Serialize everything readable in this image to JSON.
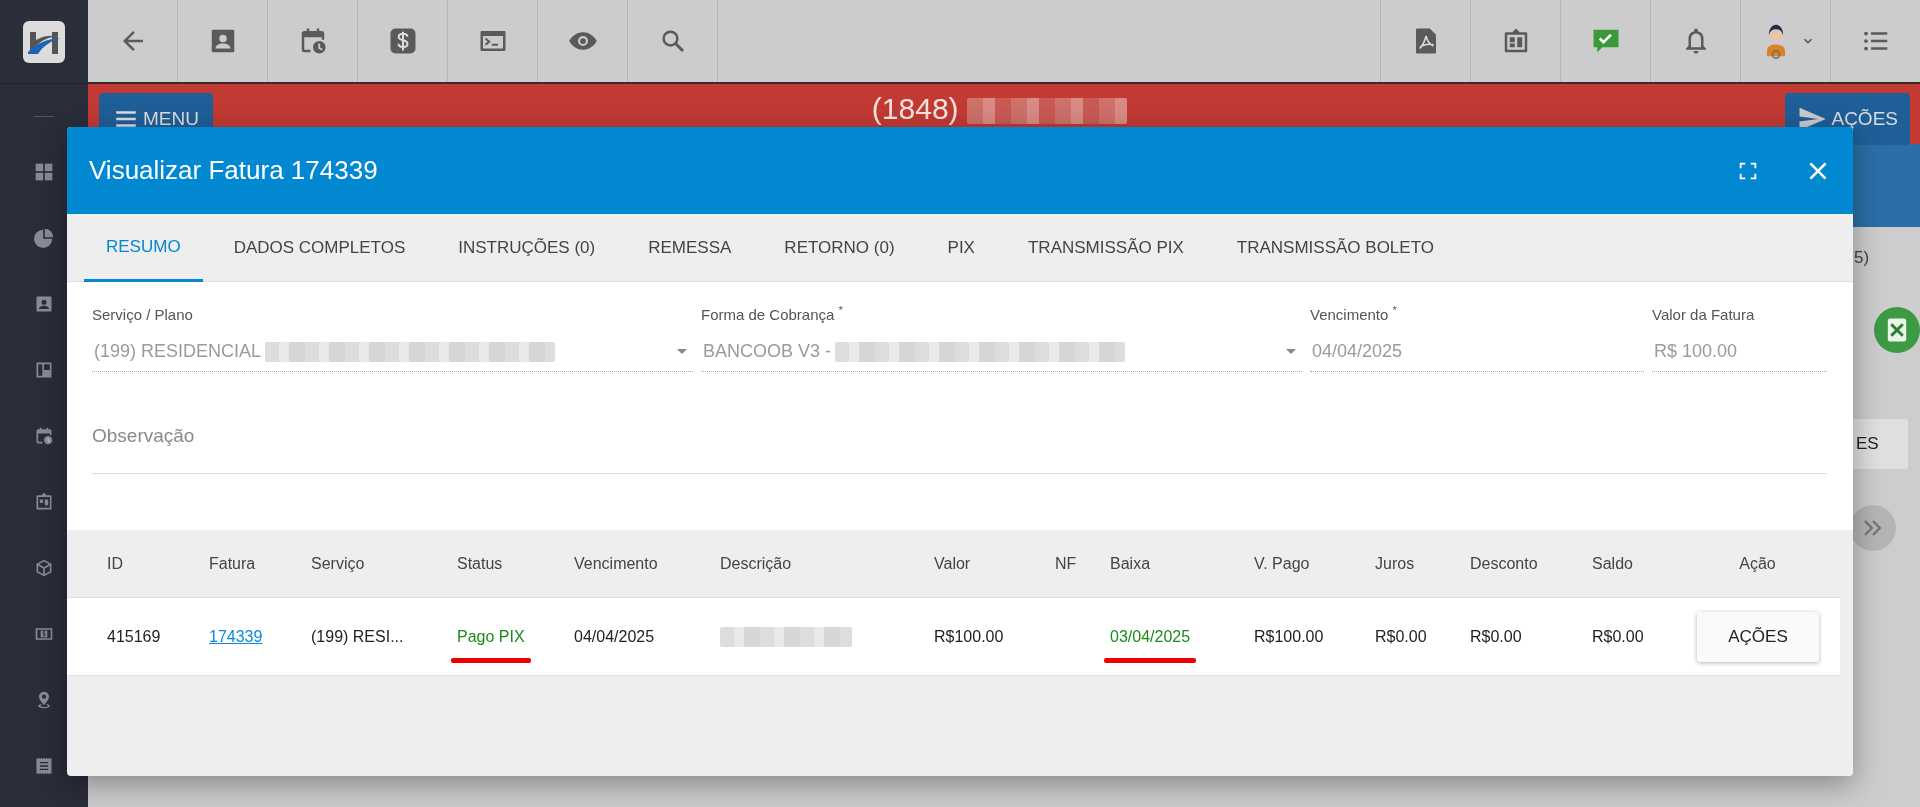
{
  "header": {
    "menu_button": "MENU",
    "client_code": "(1848)",
    "client_name_redacted": true,
    "actions_button": "AÇÕES"
  },
  "background_fragments": {
    "count_text": "5)",
    "button_text": "ES"
  },
  "modal": {
    "title": "Visualizar Fatura 174339",
    "tabs": [
      {
        "label": "RESUMO",
        "selected": true
      },
      {
        "label": "DADOS COMPLETOS",
        "selected": false
      },
      {
        "label": "INSTRUÇÕES (0)",
        "selected": false
      },
      {
        "label": "REMESSA",
        "selected": false
      },
      {
        "label": "RETORNO (0)",
        "selected": false
      },
      {
        "label": "PIX",
        "selected": false
      },
      {
        "label": "TRANSMISSÃO PIX",
        "selected": false
      },
      {
        "label": "TRANSMISSÃO BOLETO",
        "selected": false
      }
    ],
    "fields": [
      {
        "kind": "select",
        "label": "Serviço / Plano",
        "value": "(199) RESIDENCIAL",
        "redacted": true
      },
      {
        "kind": "select",
        "label": "Forma de Cobrança $^{*}$",
        "value": "BANCOOB V3 -",
        "redacted": true
      },
      {
        "kind": "text",
        "label": "Vencimento $^{*}$",
        "value": "04/04/2025",
        "redacted": false
      },
      {
        "kind": "text",
        "label": "Valor da Fatura",
        "value": "R$ 100.00",
        "redacted": false
      }
    ],
    "observation": {
      "placeholder": "Observação"
    },
    "table": {
      "columns": [
        "ID",
        "Fatura",
        "Serviço",
        "Status",
        "Vencimento",
        "Descrição",
        "Valor",
        "NF",
        "Baixa",
        "V. Pago",
        "Juros",
        "Desconto",
        "Saldo",
        "Ação"
      ],
      "rows": [
        {
          "cells": [
            {
              "kind": "text",
              "text": "415169"
            },
            {
              "kind": "link",
              "text": "174339"
            },
            {
              "kind": "text",
              "text": "(199) RESI..."
            },
            {
              "kind": "success",
              "text": "Pago PIX",
              "underlined": true
            },
            {
              "kind": "text",
              "text": "04/04/2025"
            },
            {
              "kind": "redacted"
            },
            {
              "kind": "text",
              "text": "R$100.00"
            },
            {
              "kind": "empty"
            },
            {
              "kind": "success",
              "text": "03/04/2025",
              "underlined": true
            },
            {
              "kind": "text",
              "text": "R$100.00"
            },
            {
              "kind": "text",
              "text": "R$0.00"
            },
            {
              "kind": "text",
              "text": "R$0.00"
            },
            {
              "kind": "text",
              "text": "R$0.00"
            },
            {
              "kind": "button",
              "text": "AÇÕES"
            }
          ]
        }
      ]
    }
  }
}
